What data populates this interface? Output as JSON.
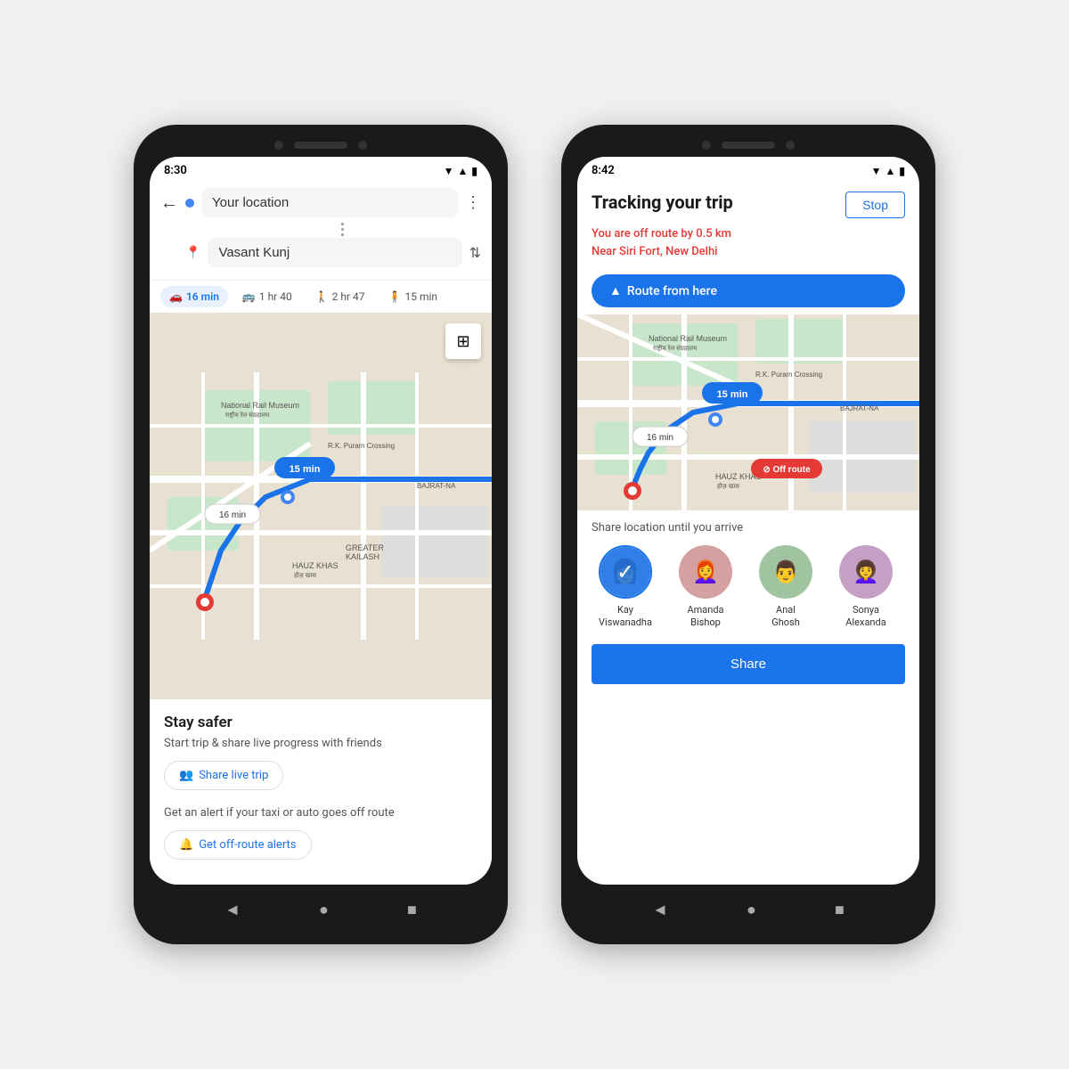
{
  "phone1": {
    "status_time": "8:30",
    "from_placeholder": "Your location",
    "to_value": "Vasant Kunj",
    "transport_tabs": [
      {
        "icon": "🚗",
        "label": "16 min",
        "active": true
      },
      {
        "icon": "🚌",
        "label": "1 hr 40",
        "active": false
      },
      {
        "icon": "🚶",
        "label": "2 hr 47",
        "active": false
      },
      {
        "icon": "🧍",
        "label": "15 min",
        "active": false
      }
    ],
    "map_labels": [
      {
        "text": "15 min",
        "type": "blue"
      },
      {
        "text": "16 min",
        "type": "outline"
      }
    ],
    "stay_safer_title": "Stay safer",
    "stay_safer_sub": "Start trip & share live progress with friends",
    "share_btn": "Share live trip",
    "off_route_sub": "Get an alert if your taxi or auto goes off route",
    "off_route_btn": "Get off-route alerts"
  },
  "phone2": {
    "status_time": "8:42",
    "tracking_title": "Tracking your trip",
    "stop_btn": "Stop",
    "off_route_line1": "You are off route by 0.5 km",
    "off_route_line2": "Near Siri Fort, New Delhi",
    "route_from_btn": "Route from here",
    "map_label_15": "15 min",
    "map_label_16": "16 min",
    "off_route_badge": "Off route",
    "share_section_title": "Share location until you arrive",
    "contacts": [
      {
        "name": "Kay\nViswanadha",
        "emoji": "👩",
        "selected": true
      },
      {
        "name": "Amanda\nBishop",
        "emoji": "👩‍🦰",
        "selected": false
      },
      {
        "name": "Anal\nGhosh",
        "emoji": "👨",
        "selected": false
      },
      {
        "name": "Sonya\nAlexanda",
        "emoji": "👩‍🦱",
        "selected": false
      }
    ],
    "share_btn": "Share"
  },
  "icons": {
    "back": "←",
    "three_dots": "⋮",
    "swap": "⇅",
    "layers": "◫",
    "share_people": "👥",
    "bell": "🔔",
    "nav_back": "◄",
    "nav_home": "●",
    "nav_square": "■",
    "nav_arrow": "▲",
    "check": "✓",
    "signal": "▲▲▲",
    "wifi": "▾",
    "battery": "▮"
  }
}
